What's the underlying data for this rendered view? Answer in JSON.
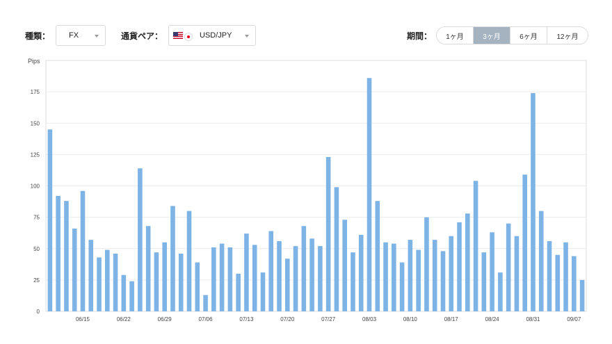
{
  "filters": {
    "type_label": "種類：",
    "type_value": "FX",
    "pair_label": "通貨ペア：",
    "pair_value": "USD/JPY",
    "pair_flags": [
      "us-flag-icon",
      "jp-flag-icon"
    ],
    "period_label": "期間：",
    "period_options": [
      "1ヶ月",
      "3ヶ月",
      "6ヶ月",
      "12ヶ月"
    ],
    "period_selected": "3ヶ月"
  },
  "colors": {
    "bar": "#7eb4e5",
    "period_active_bg": "#a4b3bf"
  },
  "chart_data": {
    "type": "bar",
    "ylabel": "Pips",
    "ylim": [
      0,
      200
    ],
    "yticks": [
      0,
      25,
      50,
      75,
      100,
      125,
      150,
      175
    ],
    "grid": true,
    "xticks": [
      {
        "label": "06/15",
        "index": 4
      },
      {
        "label": "06/22",
        "index": 9
      },
      {
        "label": "06/29",
        "index": 14
      },
      {
        "label": "07/06",
        "index": 19
      },
      {
        "label": "07/13",
        "index": 24
      },
      {
        "label": "07/20",
        "index": 29
      },
      {
        "label": "07/27",
        "index": 34
      },
      {
        "label": "08/03",
        "index": 39
      },
      {
        "label": "08/10",
        "index": 44
      },
      {
        "label": "08/17",
        "index": 49
      },
      {
        "label": "08/24",
        "index": 54
      },
      {
        "label": "08/31",
        "index": 59
      },
      {
        "label": "09/07",
        "index": 64
      }
    ],
    "values": [
      145,
      92,
      88,
      66,
      96,
      57,
      43,
      49,
      46,
      29,
      24,
      114,
      68,
      47,
      55,
      84,
      46,
      80,
      39,
      13,
      51,
      54,
      51,
      30,
      62,
      53,
      31,
      64,
      56,
      42,
      52,
      68,
      58,
      52,
      123,
      99,
      73,
      47,
      61,
      186,
      88,
      55,
      54,
      39,
      57,
      49,
      75,
      57,
      48,
      60,
      71,
      78,
      104,
      47,
      63,
      31,
      70,
      60,
      109,
      174,
      80,
      56,
      45,
      55,
      44,
      25
    ]
  }
}
